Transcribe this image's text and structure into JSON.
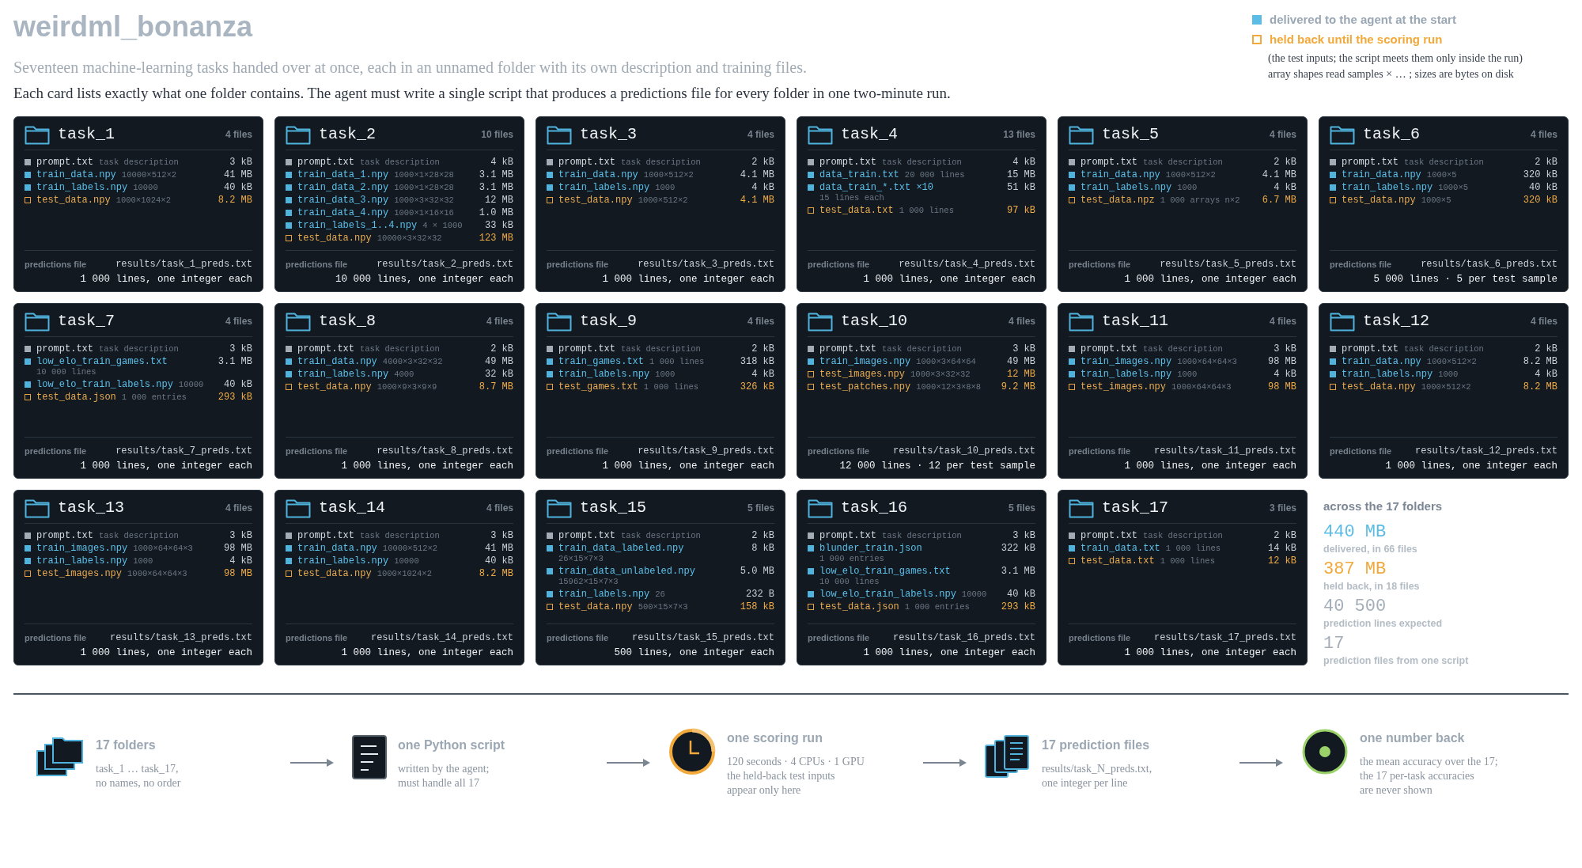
{
  "title": "weirdml_bonanza",
  "subtitle": "Seventeen machine-learning tasks handed over at once, each in an unnamed folder with its own description and training files.",
  "intro": "Each card lists exactly what one folder contains. The agent must write a single script that produces a predictions file for every folder in one two-minute run.",
  "legend": {
    "items": [
      {
        "kind": "delivered",
        "label": "delivered to the agent at the start"
      },
      {
        "kind": "held",
        "label": "held back until the scoring run"
      }
    ],
    "notes": [
      "(the test inputs; the script meets them only inside the run)",
      "array shapes read samples × … ;  sizes are bytes on disk"
    ]
  },
  "tasks": [
    {
      "name": "task_1",
      "count": "4 files",
      "files": [
        {
          "kind": "prompt",
          "name": "prompt.txt",
          "note": "task description",
          "size": "3 kB"
        },
        {
          "kind": "train",
          "name": "train_data.npy",
          "note": "10000×512×2",
          "size": "41 MB"
        },
        {
          "kind": "train",
          "name": "train_labels.npy",
          "note": "10000",
          "size": "40 kB"
        },
        {
          "kind": "test",
          "name": "test_data.npy",
          "note": "1000×1024×2",
          "size": "8.2 MB"
        }
      ],
      "preds_label": "predictions file",
      "preds_path": "results/task_1_preds.txt",
      "preds_lines": "1 000 lines, one integer each"
    },
    {
      "name": "task_2",
      "count": "10 files",
      "files": [
        {
          "kind": "prompt",
          "name": "prompt.txt",
          "note": "task description",
          "size": "4 kB"
        },
        {
          "kind": "train",
          "name": "train_data_1.npy",
          "note": "1000×1×28×28",
          "size": "3.1 MB"
        },
        {
          "kind": "train",
          "name": "train_data_2.npy",
          "note": "1000×1×28×28",
          "size": "3.1 MB"
        },
        {
          "kind": "train",
          "name": "train_data_3.npy",
          "note": "1000×3×32×32",
          "size": "12 MB"
        },
        {
          "kind": "train",
          "name": "train_data_4.npy",
          "note": "1000×1×16×16",
          "size": "1.0 MB"
        },
        {
          "kind": "train",
          "name": "train_labels_1..4.npy",
          "note": "4 × 1000",
          "size": "33 kB"
        },
        {
          "kind": "test",
          "name": "test_data.npy",
          "note": "10000×3×32×32",
          "size": "123 MB"
        }
      ],
      "preds_label": "predictions file",
      "preds_path": "results/task_2_preds.txt",
      "preds_lines": "10 000 lines, one integer each"
    },
    {
      "name": "task_3",
      "count": "4 files",
      "files": [
        {
          "kind": "prompt",
          "name": "prompt.txt",
          "note": "task description",
          "size": "2 kB"
        },
        {
          "kind": "train",
          "name": "train_data.npy",
          "note": "1000×512×2",
          "size": "4.1 MB"
        },
        {
          "kind": "train",
          "name": "train_labels.npy",
          "note": "1000",
          "size": "4 kB"
        },
        {
          "kind": "test",
          "name": "test_data.npy",
          "note": "1000×512×2",
          "size": "4.1 MB"
        }
      ],
      "preds_label": "predictions file",
      "preds_path": "results/task_3_preds.txt",
      "preds_lines": "1 000 lines, one integer each"
    },
    {
      "name": "task_4",
      "count": "13 files",
      "files": [
        {
          "kind": "prompt",
          "name": "prompt.txt",
          "note": "task description",
          "size": "4 kB"
        },
        {
          "kind": "train",
          "name": "data_train.txt",
          "note": "20 000 lines",
          "size": "15 MB"
        },
        {
          "kind": "train",
          "name": "data_train_*.txt ×10",
          "sub": "15 lines each",
          "size": "51 kB"
        },
        {
          "kind": "test",
          "name": "test_data.txt",
          "note": "1 000 lines",
          "size": "97 kB"
        }
      ],
      "preds_label": "predictions file",
      "preds_path": "results/task_4_preds.txt",
      "preds_lines": "1 000 lines, one integer each"
    },
    {
      "name": "task_5",
      "count": "4 files",
      "files": [
        {
          "kind": "prompt",
          "name": "prompt.txt",
          "note": "task description",
          "size": "2 kB"
        },
        {
          "kind": "train",
          "name": "train_data.npy",
          "note": "1000×512×2",
          "size": "4.1 MB"
        },
        {
          "kind": "train",
          "name": "train_labels.npy",
          "note": "1000",
          "size": "4 kB"
        },
        {
          "kind": "test",
          "name": "test_data.npz",
          "note": "1 000 arrays n×2",
          "size": "6.7 MB"
        }
      ],
      "preds_label": "predictions file",
      "preds_path": "results/task_5_preds.txt",
      "preds_lines": "1 000 lines, one integer each"
    },
    {
      "name": "task_6",
      "count": "4 files",
      "files": [
        {
          "kind": "prompt",
          "name": "prompt.txt",
          "note": "task description",
          "size": "2 kB"
        },
        {
          "kind": "train",
          "name": "train_data.npy",
          "note": "1000×5",
          "size": "320 kB"
        },
        {
          "kind": "train",
          "name": "train_labels.npy",
          "note": "1000×5",
          "size": "40 kB"
        },
        {
          "kind": "test",
          "name": "test_data.npy",
          "note": "1000×5",
          "size": "320 kB"
        }
      ],
      "preds_label": "predictions file",
      "preds_path": "results/task_6_preds.txt",
      "preds_lines": "5 000 lines · 5 per test sample"
    },
    {
      "name": "task_7",
      "count": "4 files",
      "files": [
        {
          "kind": "prompt",
          "name": "prompt.txt",
          "note": "task description",
          "size": "3 kB"
        },
        {
          "kind": "train",
          "name": "low_elo_train_games.txt",
          "sub": "10 000 lines",
          "size": "3.1 MB"
        },
        {
          "kind": "train",
          "name": "low_elo_train_labels.npy",
          "note": "10000",
          "size": "40 kB"
        },
        {
          "kind": "test",
          "name": "test_data.json",
          "note": "1 000 entries",
          "size": "293 kB"
        }
      ],
      "preds_label": "predictions file",
      "preds_path": "results/task_7_preds.txt",
      "preds_lines": "1 000 lines, one integer each"
    },
    {
      "name": "task_8",
      "count": "4 files",
      "files": [
        {
          "kind": "prompt",
          "name": "prompt.txt",
          "note": "task description",
          "size": "2 kB"
        },
        {
          "kind": "train",
          "name": "train_data.npy",
          "note": "4000×3×32×32",
          "size": "49 MB"
        },
        {
          "kind": "train",
          "name": "train_labels.npy",
          "note": "4000",
          "size": "32 kB"
        },
        {
          "kind": "test",
          "name": "test_data.npy",
          "note": "1000×9×3×9×9",
          "size": "8.7 MB"
        }
      ],
      "preds_label": "predictions file",
      "preds_path": "results/task_8_preds.txt",
      "preds_lines": "1 000 lines, one integer each"
    },
    {
      "name": "task_9",
      "count": "4 files",
      "files": [
        {
          "kind": "prompt",
          "name": "prompt.txt",
          "note": "task description",
          "size": "2 kB"
        },
        {
          "kind": "train",
          "name": "train_games.txt",
          "note": "1 000 lines",
          "size": "318 kB"
        },
        {
          "kind": "train",
          "name": "train_labels.npy",
          "note": "1000",
          "size": "4 kB"
        },
        {
          "kind": "test",
          "name": "test_games.txt",
          "note": "1 000 lines",
          "size": "326 kB"
        }
      ],
      "preds_label": "predictions file",
      "preds_path": "results/task_9_preds.txt",
      "preds_lines": "1 000 lines, one integer each"
    },
    {
      "name": "task_10",
      "count": "4 files",
      "files": [
        {
          "kind": "prompt",
          "name": "prompt.txt",
          "note": "task description",
          "size": "3 kB"
        },
        {
          "kind": "train",
          "name": "train_images.npy",
          "note": "1000×3×64×64",
          "size": "49 MB"
        },
        {
          "kind": "test",
          "name": "test_images.npy",
          "note": "1000×3×32×32",
          "size": "12 MB"
        },
        {
          "kind": "test",
          "name": "test_patches.npy",
          "note": "1000×12×3×8×8",
          "size": "9.2 MB"
        }
      ],
      "preds_label": "predictions file",
      "preds_path": "results/task_10_preds.txt",
      "preds_lines": "12 000 lines · 12 per test sample"
    },
    {
      "name": "task_11",
      "count": "4 files",
      "files": [
        {
          "kind": "prompt",
          "name": "prompt.txt",
          "note": "task description",
          "size": "3 kB"
        },
        {
          "kind": "train",
          "name": "train_images.npy",
          "note": "1000×64×64×3",
          "size": "98 MB"
        },
        {
          "kind": "train",
          "name": "train_labels.npy",
          "note": "1000",
          "size": "4 kB"
        },
        {
          "kind": "test",
          "name": "test_images.npy",
          "note": "1000×64×64×3",
          "size": "98 MB"
        }
      ],
      "preds_label": "predictions file",
      "preds_path": "results/task_11_preds.txt",
      "preds_lines": "1 000 lines, one integer each"
    },
    {
      "name": "task_12",
      "count": "4 files",
      "files": [
        {
          "kind": "prompt",
          "name": "prompt.txt",
          "note": "task description",
          "size": "2 kB"
        },
        {
          "kind": "train",
          "name": "train_data.npy",
          "note": "1000×512×2",
          "size": "8.2 MB"
        },
        {
          "kind": "train",
          "name": "train_labels.npy",
          "note": "1000",
          "size": "4 kB"
        },
        {
          "kind": "test",
          "name": "test_data.npy",
          "note": "1000×512×2",
          "size": "8.2 MB"
        }
      ],
      "preds_label": "predictions file",
      "preds_path": "results/task_12_preds.txt",
      "preds_lines": "1 000 lines, one integer each"
    },
    {
      "name": "task_13",
      "count": "4 files",
      "files": [
        {
          "kind": "prompt",
          "name": "prompt.txt",
          "note": "task description",
          "size": "3 kB"
        },
        {
          "kind": "train",
          "name": "train_images.npy",
          "note": "1000×64×64×3",
          "size": "98 MB"
        },
        {
          "kind": "train",
          "name": "train_labels.npy",
          "note": "1000",
          "size": "4 kB"
        },
        {
          "kind": "test",
          "name": "test_images.npy",
          "note": "1000×64×64×3",
          "size": "98 MB"
        }
      ],
      "preds_label": "predictions file",
      "preds_path": "results/task_13_preds.txt",
      "preds_lines": "1 000 lines, one integer each"
    },
    {
      "name": "task_14",
      "count": "4 files",
      "files": [
        {
          "kind": "prompt",
          "name": "prompt.txt",
          "note": "task description",
          "size": "3 kB"
        },
        {
          "kind": "train",
          "name": "train_data.npy",
          "note": "10000×512×2",
          "size": "41 MB"
        },
        {
          "kind": "train",
          "name": "train_labels.npy",
          "note": "10000",
          "size": "40 kB"
        },
        {
          "kind": "test",
          "name": "test_data.npy",
          "note": "1000×1024×2",
          "size": "8.2 MB"
        }
      ],
      "preds_label": "predictions file",
      "preds_path": "results/task_14_preds.txt",
      "preds_lines": "1 000 lines, one integer each"
    },
    {
      "name": "task_15",
      "count": "5 files",
      "files": [
        {
          "kind": "prompt",
          "name": "prompt.txt",
          "note": "task description",
          "size": "2 kB"
        },
        {
          "kind": "train",
          "name": "train_data_labeled.npy",
          "sub": "26×15×7×3",
          "size": "8 kB"
        },
        {
          "kind": "train",
          "name": "train_data_unlabeled.npy",
          "sub": "15962×15×7×3",
          "size": "5.0 MB"
        },
        {
          "kind": "train",
          "name": "train_labels.npy",
          "note": "26",
          "size": "232 B"
        },
        {
          "kind": "test",
          "name": "test_data.npy",
          "note": "500×15×7×3",
          "size": "158 kB"
        }
      ],
      "preds_label": "predictions file",
      "preds_path": "results/task_15_preds.txt",
      "preds_lines": "500 lines, one integer each"
    },
    {
      "name": "task_16",
      "count": "5 files",
      "files": [
        {
          "kind": "prompt",
          "name": "prompt.txt",
          "note": "task description",
          "size": "3 kB"
        },
        {
          "kind": "train",
          "name": "blunder_train.json",
          "sub": "1 000 entries",
          "size": "322 kB"
        },
        {
          "kind": "train",
          "name": "low_elo_train_games.txt",
          "sub": "10 000 lines",
          "size": "3.1 MB"
        },
        {
          "kind": "train",
          "name": "low_elo_train_labels.npy",
          "note": "10000",
          "size": "40 kB"
        },
        {
          "kind": "test",
          "name": "test_data.json",
          "note": "1 000 entries",
          "size": "293 kB"
        }
      ],
      "preds_label": "predictions file",
      "preds_path": "results/task_16_preds.txt",
      "preds_lines": "1 000 lines, one integer each"
    },
    {
      "name": "task_17",
      "count": "3 files",
      "files": [
        {
          "kind": "prompt",
          "name": "prompt.txt",
          "note": "task description",
          "size": "2 kB"
        },
        {
          "kind": "train",
          "name": "train_data.txt",
          "note": "1 000 lines",
          "size": "14 kB"
        },
        {
          "kind": "test",
          "name": "test_data.txt",
          "note": "1 000 lines",
          "size": "12 kB"
        }
      ],
      "preds_label": "predictions file",
      "preds_path": "results/task_17_preds.txt",
      "preds_lines": "1 000 lines, one integer each"
    }
  ],
  "totals": {
    "heading": "across the 17 folders",
    "stats": [
      {
        "value": "440 MB",
        "label": "delivered, in 66 files",
        "color": "#5bbde6"
      },
      {
        "value": "387 MB",
        "label": "held back, in 18 files",
        "color": "#f2a93b"
      },
      {
        "value": "40 500",
        "label": "prediction lines expected",
        "color": "#a3aeb9"
      },
      {
        "value": "17",
        "label": "prediction files from one script",
        "color": "#a3aeb9"
      }
    ]
  },
  "flow": [
    {
      "kind": "folders",
      "title": "17 folders",
      "lines": [
        "task_1 … task_17,",
        "no names, no order"
      ]
    },
    {
      "kind": "script",
      "title": "one Python script",
      "lines": [
        "written by the agent;",
        "must handle all 17"
      ]
    },
    {
      "kind": "clock",
      "title": "one scoring run",
      "lines": [
        "120 seconds · 4 CPUs · 1 GPU",
        "the held-back test inputs",
        "appear only here"
      ]
    },
    {
      "kind": "files",
      "title": "17 prediction files",
      "lines": [
        "results/task_N_preds.txt,",
        "one integer per line"
      ]
    },
    {
      "kind": "target",
      "title": "one number back",
      "lines": [
        "the mean accuracy over the 17;",
        "the 17 per-task accuracies",
        "are never shown"
      ]
    }
  ]
}
